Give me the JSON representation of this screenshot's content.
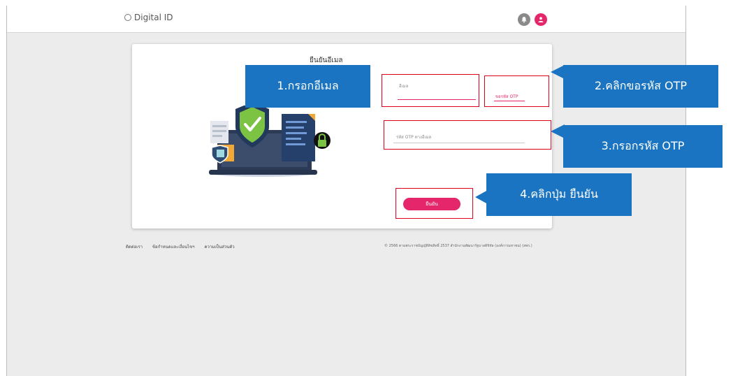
{
  "header": {
    "brand": "Digital ID",
    "icons": [
      "fingerprint-icon",
      "bell-icon",
      "user-icon"
    ]
  },
  "card": {
    "title": "ยืนยันอีเมล",
    "email_label": "อีเมล",
    "otp_request": "ขอรหัส OTP",
    "otp_placeholder": "รหัส OTP ทางอีเมล",
    "confirm": "ยืนยัน"
  },
  "annotations": {
    "step1": "1.กรอกอีเมล",
    "step2": "2.คลิกขอรหัส OTP",
    "step3": "3.กรอกรหัส OTP",
    "step4": "4.คลิกปุ่ม ยืนยัน"
  },
  "footer": {
    "links": [
      "ติดต่อเรา",
      "ข้อกำหนดและเงื่อนไขฯ",
      "ความเป็นส่วนตัว"
    ],
    "copyright": "© 2566 ตามพระราชบัญญัติลิขสิทธิ์ 2537 สำนักงานพัฒนารัฐบาลดิจิทัล (องค์การมหาชน) (สพร.)"
  },
  "colors": {
    "accent": "#e5266a",
    "callout": "#1a74c1",
    "highlight": "#e0001b"
  }
}
